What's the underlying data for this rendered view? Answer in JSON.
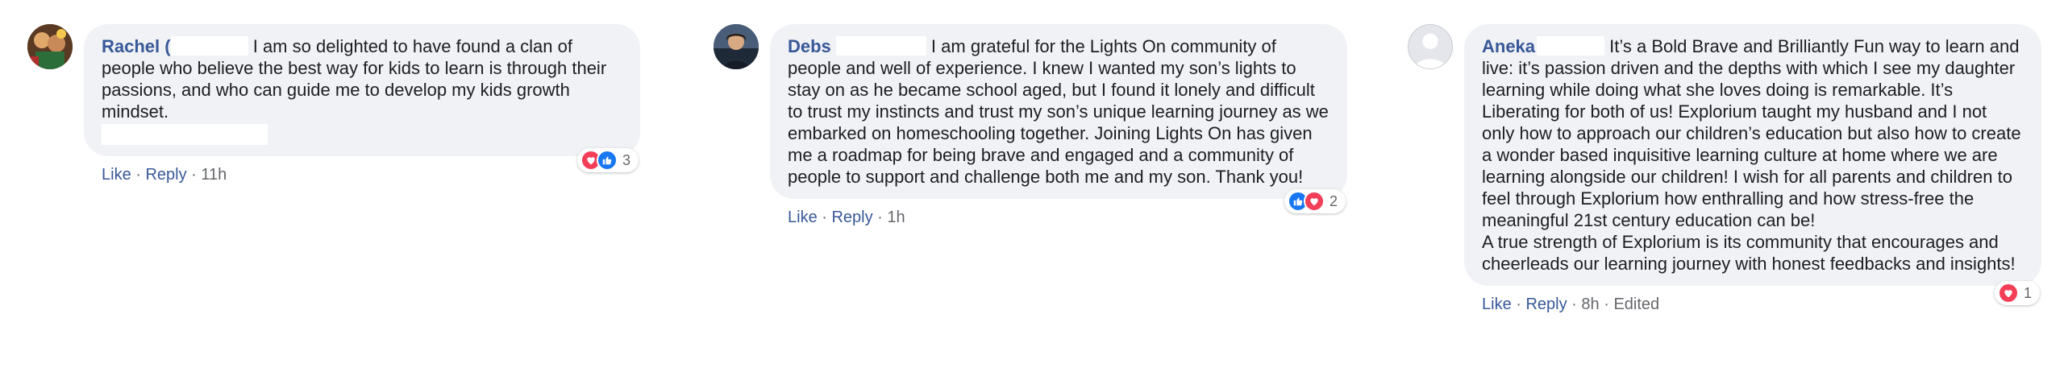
{
  "comments": [
    {
      "author": "Rachel (",
      "text": "I am so delighted to have found a clan of people who believe the best way for kids to learn is through their passions, and who can guide me to develop my kids growth mindset.",
      "reactions": [
        "love",
        "like"
      ],
      "reaction_count": "3",
      "like_label": "Like",
      "reply_label": "Reply",
      "time": "11h"
    },
    {
      "author": "Debs",
      "text": "I am grateful for the Lights On community of people and well of experience. I knew I wanted my son’s lights to stay on as he became school aged, but I found it lonely and difficult to trust my instincts and trust my son’s unique learning journey as we embarked on homeschooling together. Joining Lights On has given me a roadmap for being brave and engaged and a community of people to support and challenge both me and my son. Thank you!",
      "reactions": [
        "like",
        "love"
      ],
      "reaction_count": "2",
      "like_label": "Like",
      "reply_label": "Reply",
      "time": "1h"
    },
    {
      "author": "Aneka",
      "text": "It’s a Bold Brave and Brilliantly Fun way to learn and live: it’s passion driven and the depths with which I see my daughter learning while doing what she loves doing is remarkable. It’s Liberating for both of us! Explorium taught my husband and I not only how to approach our children’s education but also how to create a wonder based inquisitive learning culture at home where we are learning alongside our children! I wish for all parents and children to feel through Explorium how enthralling and how stress-free the meaningful 21st century education can be!",
      "text2": "A true strength of Explorium is its community that encourages and cheerleads our learning journey with honest feedbacks and insights!",
      "reactions": [
        "love"
      ],
      "reaction_count": "1",
      "like_label": "Like",
      "reply_label": "Reply",
      "time": "8h",
      "edited": "Edited"
    }
  ],
  "colors": {
    "author": "#385898",
    "bubble": "#f0f2f5",
    "like_blue": "#1877f2",
    "love_red": "#f33e58"
  }
}
